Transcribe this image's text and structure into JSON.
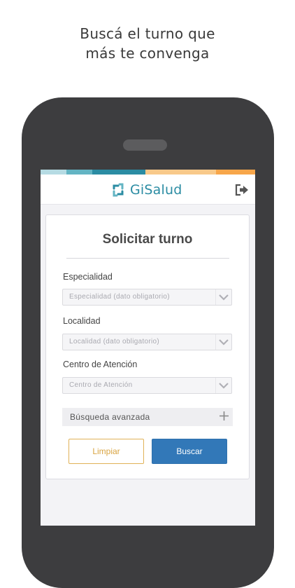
{
  "promo": {
    "line1": "Buscá el turno que",
    "line2": "más te convenga"
  },
  "colors": {
    "stripes": [
      "#b6dbe3",
      "#63b4c3",
      "#2b8ca3",
      "#f8c98a",
      "#f7a64a"
    ],
    "brand": "#2b8ca3",
    "primary_button": "#3278b8",
    "secondary_button": "#e0b257"
  },
  "app": {
    "brand_name": "GiSalud",
    "logo_icon": "gisalud-logo-icon",
    "logout_icon": "logout-icon"
  },
  "form": {
    "title": "Solicitar turno",
    "fields": [
      {
        "label": "Especialidad",
        "placeholder": "Especialidad (dato obligatorio)"
      },
      {
        "label": "Localidad",
        "placeholder": "Localidad (dato obligatorio)"
      },
      {
        "label": "Centro de Atención",
        "placeholder": "Centro de Atención"
      }
    ],
    "advanced_search": "Búsqueda avanzada",
    "clear_label": "Limpiar",
    "search_label": "Buscar"
  }
}
